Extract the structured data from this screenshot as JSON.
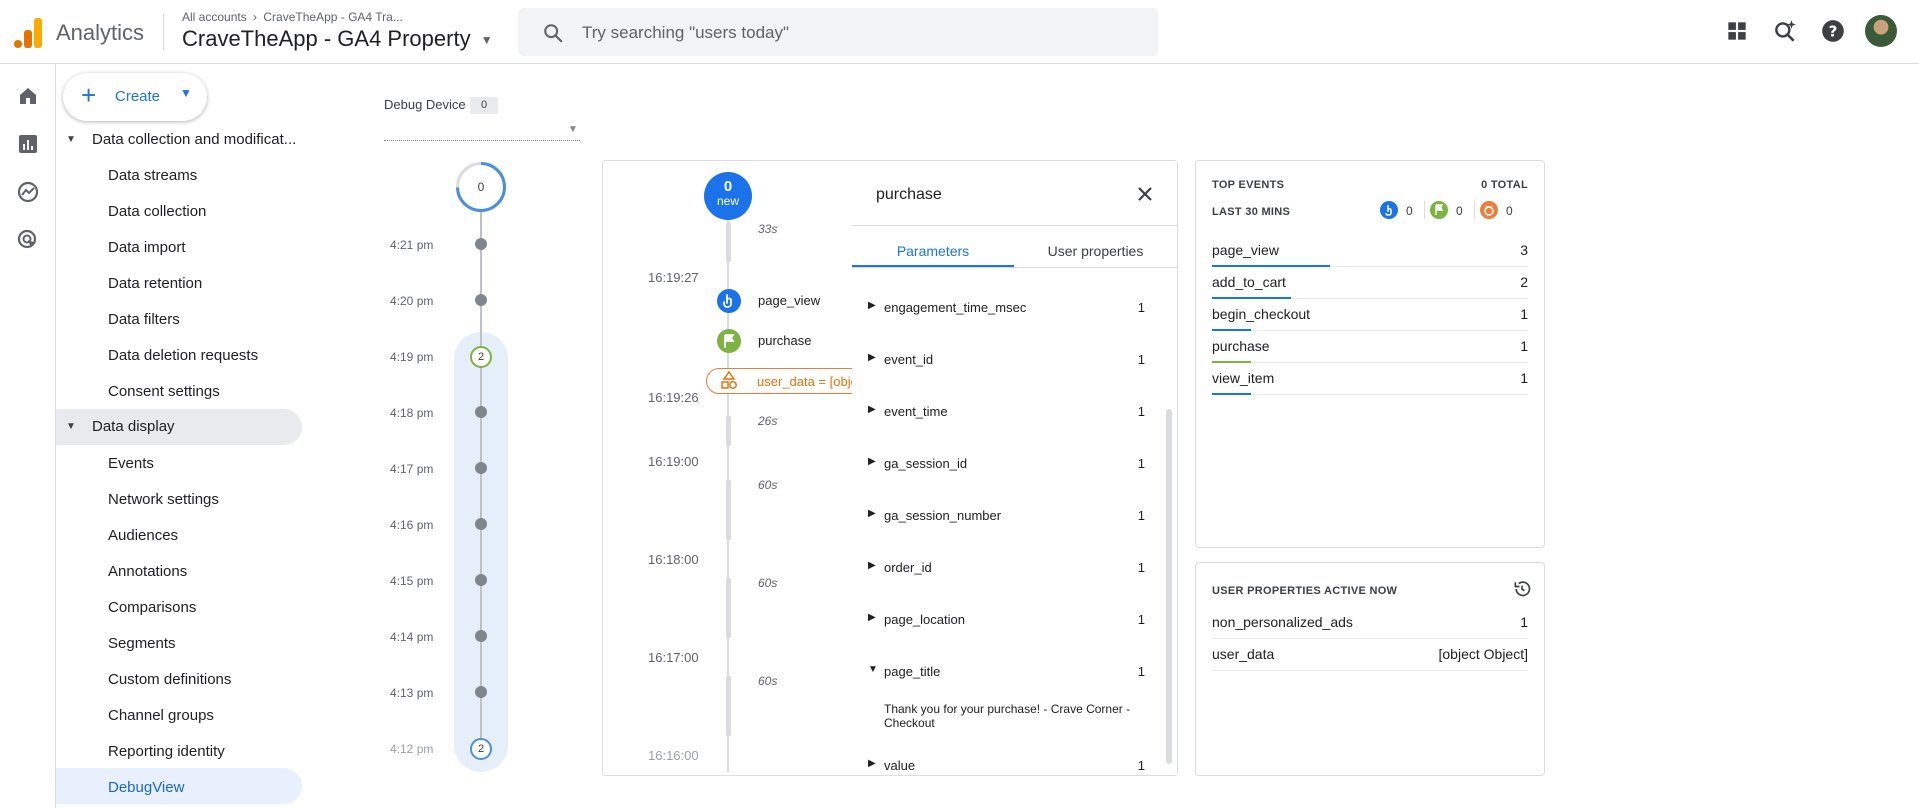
{
  "header": {
    "app_name": "Analytics",
    "breadcrumb_all": "All accounts",
    "breadcrumb_sep": "›",
    "breadcrumb_account": "CraveTheApp - GA4 Tra...",
    "property_name": "CraveTheApp - GA4 Property",
    "search_placeholder": "Try searching \"users today\""
  },
  "create_button": {
    "label": "Create"
  },
  "nav": {
    "section_collection": "Data collection and modificat...",
    "collection_items": [
      "Data streams",
      "Data collection",
      "Data import",
      "Data retention",
      "Data filters",
      "Data deletion requests",
      "Consent settings"
    ],
    "section_display": "Data display",
    "display_items": [
      "Events",
      "Network settings",
      "Audiences",
      "Annotations",
      "Comparisons",
      "Segments",
      "Custom definitions",
      "Channel groups",
      "Reporting identity",
      "DebugView"
    ]
  },
  "debug_device": {
    "label": "Debug Device",
    "count": "0"
  },
  "minutes_stream": {
    "top_count": "0",
    "times": [
      "4:21 pm",
      "4:20 pm",
      "4:19 pm",
      "4:18 pm",
      "4:17 pm",
      "4:16 pm",
      "4:15 pm",
      "4:14 pm",
      "4:13 pm",
      "4:12 pm"
    ],
    "badge_4_19": "2",
    "badge_4_12": "2"
  },
  "seconds_stream": {
    "new_count": "0",
    "new_label": "new",
    "gap_top": "33s",
    "times": [
      "16:19:27",
      "16:19:26",
      "16:19:00",
      "16:18:00",
      "16:17:00",
      "16:16:00"
    ],
    "gaps": [
      "26s",
      "60s",
      "60s",
      "60s"
    ],
    "events": [
      {
        "name": "page_view"
      },
      {
        "name": "purchase"
      }
    ],
    "error_event": "user_data = [obje"
  },
  "detail": {
    "title": "purchase",
    "tabs": [
      "Parameters",
      "User properties"
    ],
    "params": [
      {
        "key": "engagement_time_msec",
        "value": "1"
      },
      {
        "key": "event_id",
        "value": "1"
      },
      {
        "key": "event_time",
        "value": "1"
      },
      {
        "key": "ga_session_id",
        "value": "1"
      },
      {
        "key": "ga_session_number",
        "value": "1"
      },
      {
        "key": "order_id",
        "value": "1"
      },
      {
        "key": "page_location",
        "value": "1"
      },
      {
        "key": "page_title",
        "value": "1"
      },
      {
        "key": "value",
        "value": "1"
      }
    ],
    "page_title_value": "Thank you for your purchase! - Crave Corner - Checkout"
  },
  "top_events": {
    "title": "TOP EVENTS",
    "total": "0 TOTAL",
    "period": "LAST 30 MINS",
    "counts": [
      "0",
      "0",
      "0"
    ],
    "rows": [
      {
        "name": "page_view",
        "count": "3",
        "share": 1.0,
        "color": "#1a73e8"
      },
      {
        "name": "add_to_cart",
        "count": "2",
        "share": 0.67,
        "color": "#1a73e8"
      },
      {
        "name": "begin_checkout",
        "count": "1",
        "share": 0.33,
        "color": "#1a73e8"
      },
      {
        "name": "purchase",
        "count": "1",
        "share": 0.33,
        "color": "#7cb342"
      },
      {
        "name": "view_item",
        "count": "1",
        "share": 0.33,
        "color": "#1a73e8"
      }
    ]
  },
  "user_properties": {
    "title": "USER PROPERTIES ACTIVE NOW",
    "rows": [
      {
        "name": "non_personalized_ads",
        "value": "1"
      },
      {
        "name": "user_data",
        "value": "[object Object]"
      }
    ]
  },
  "colors": {
    "accent": "#1a73e8",
    "conversion": "#7cb342",
    "error": "#e8710a",
    "logo_orange": "#f9ab00",
    "logo_dark": "#e37400"
  }
}
